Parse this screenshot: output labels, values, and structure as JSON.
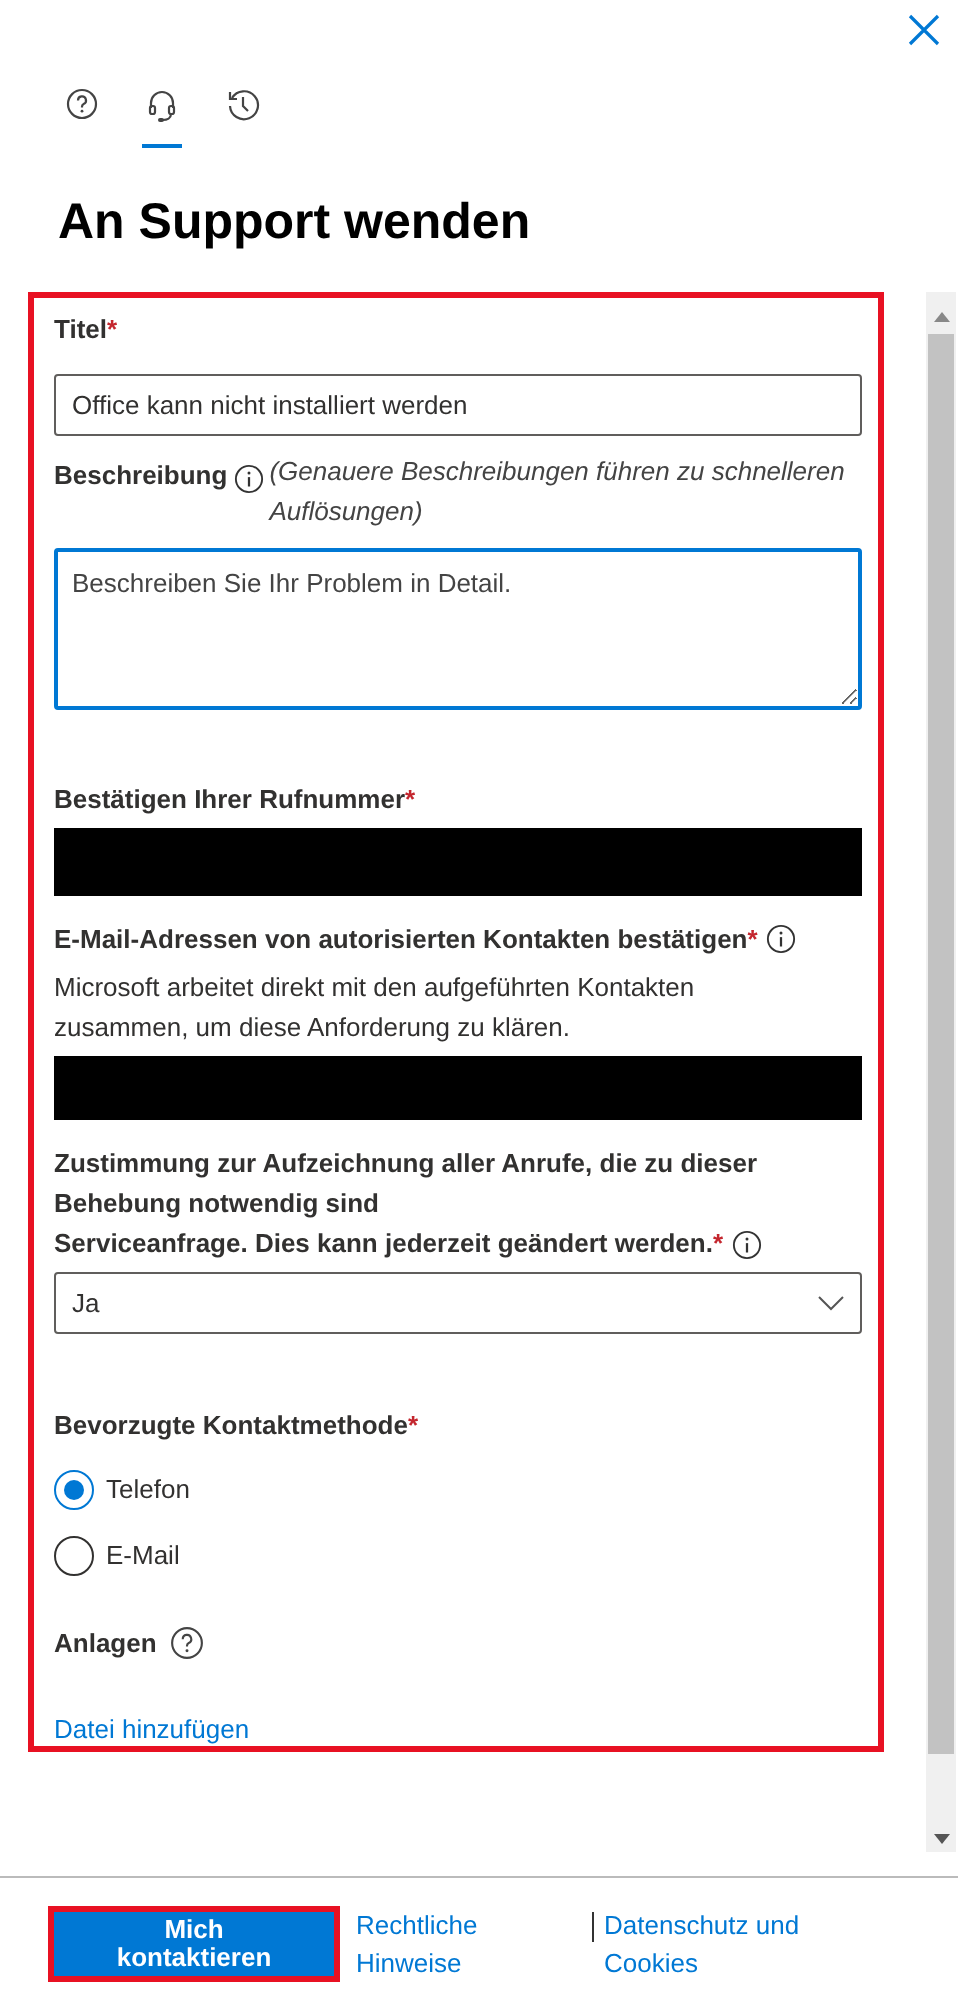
{
  "tabs": [
    {
      "kind": "help",
      "selected": false
    },
    {
      "kind": "headset",
      "selected": true
    },
    {
      "kind": "history",
      "selected": false
    }
  ],
  "heading": "An Support wenden",
  "form": {
    "highlighted": true,
    "title_field": {
      "label": "Titel",
      "required_mark": "*",
      "value": "Office kann nicht installiert werden"
    },
    "description": {
      "label": "Beschreibung",
      "hint": "(Genauere Beschreibungen führen zu schnelleren Auflösungen)",
      "placeholder": "Beschreiben Sie Ihr Problem in Detail.",
      "focused": true
    },
    "phone": {
      "label": "Bestätigen Ihrer Rufnummer",
      "required_mark": "*",
      "redacted": true
    },
    "emails": {
      "label": "E-Mail-Adressen von autorisierten Kontakten bestätigen",
      "required_mark": "*",
      "note": "Microsoft arbeitet direkt mit den aufgeführten Kontakten zusammen, um diese Anforderung zu klären.",
      "redacted": true
    },
    "consent": {
      "label_lines": [
        "Zustimmung zur Aufzeichnung aller Anrufe, die zu dieser",
        "Behebung notwendig sind",
        "Serviceanfrage. Dies kann jederzeit geändert werden."
      ],
      "required_mark": "*",
      "value": "Ja"
    },
    "contact_method": {
      "label": "Bevorzugte Kontaktmethode",
      "required_mark": "*",
      "options": [
        {
          "label": "Telefon",
          "selected": true
        },
        {
          "label": "E-Mail",
          "selected": false
        }
      ]
    },
    "attachments": {
      "label": "Anlagen",
      "link": "Datei hinzufügen"
    }
  },
  "footer": {
    "button": {
      "label": "Mich kontaktieren",
      "highlighted": true
    },
    "links": [
      "Rechtliche Hinweise",
      "Datenschutz und Cookies"
    ]
  }
}
